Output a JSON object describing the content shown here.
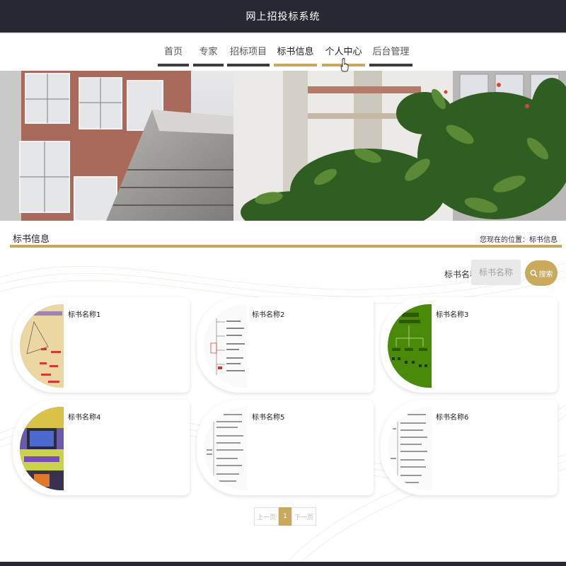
{
  "app": {
    "title": "网上招投标系统"
  },
  "nav": {
    "items": [
      {
        "label": "首页"
      },
      {
        "label": "专家"
      },
      {
        "label": "招标项目"
      },
      {
        "label": "标书信息"
      },
      {
        "label": "个人中心"
      },
      {
        "label": "后台管理"
      }
    ]
  },
  "section": {
    "title": "标书信息",
    "breadcrumb": "您现在的位置：标书信息"
  },
  "search": {
    "label": "标书名称",
    "placeholder": "标书名称",
    "button_label": "搜索"
  },
  "cards": [
    {
      "title": "标书名称1"
    },
    {
      "title": "标书名称2"
    },
    {
      "title": "标书名称3"
    },
    {
      "title": "标书名称4"
    },
    {
      "title": "标书名称5"
    },
    {
      "title": "标书名称6"
    }
  ],
  "pagination": {
    "prev_label": "上一页",
    "current_page": "1",
    "next_label": "下一页"
  },
  "colors": {
    "accent": "#c8a95d",
    "header_bg": "#262932"
  }
}
